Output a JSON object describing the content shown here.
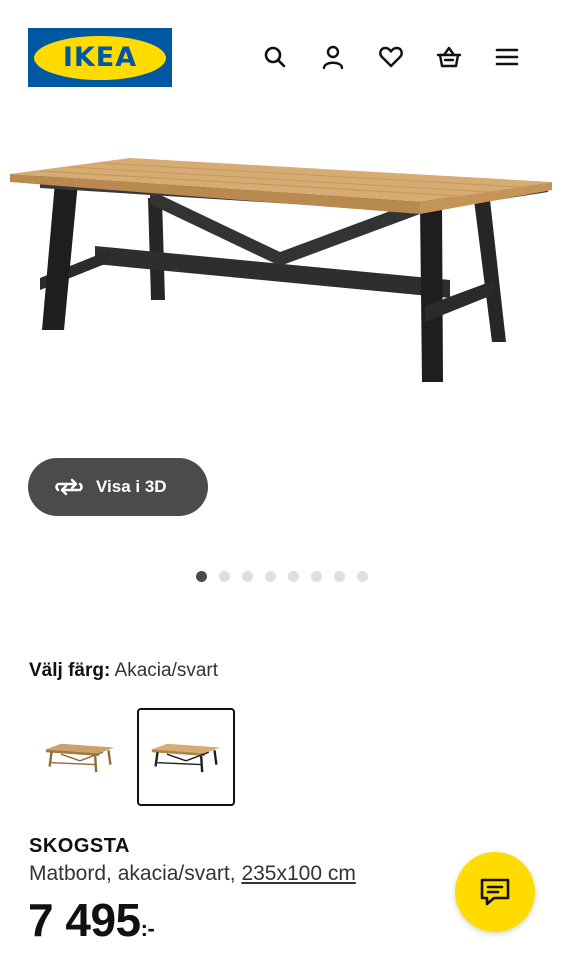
{
  "header": {
    "logo_text": "IKEA",
    "icons": [
      "search-icon",
      "user-icon",
      "heart-icon",
      "basket-icon",
      "menu-icon"
    ]
  },
  "gallery": {
    "view_3d_label": "Visa i 3D",
    "slide_count": 8,
    "active_slide": 1
  },
  "color_selector": {
    "label": "Välj färg:",
    "value": "Akacia/svart",
    "options": [
      "Akacia",
      "Akacia/svart"
    ],
    "selected_index": 1
  },
  "product": {
    "name": "SKOGSTA",
    "description": "Matbord, akacia/svart,",
    "size": "235x100 cm",
    "price": "7 495",
    "price_suffix": ":-"
  },
  "colors": {
    "brand_blue": "#0058a3",
    "brand_yellow": "#ffdb00",
    "pill_bg": "#4b4b4b"
  }
}
